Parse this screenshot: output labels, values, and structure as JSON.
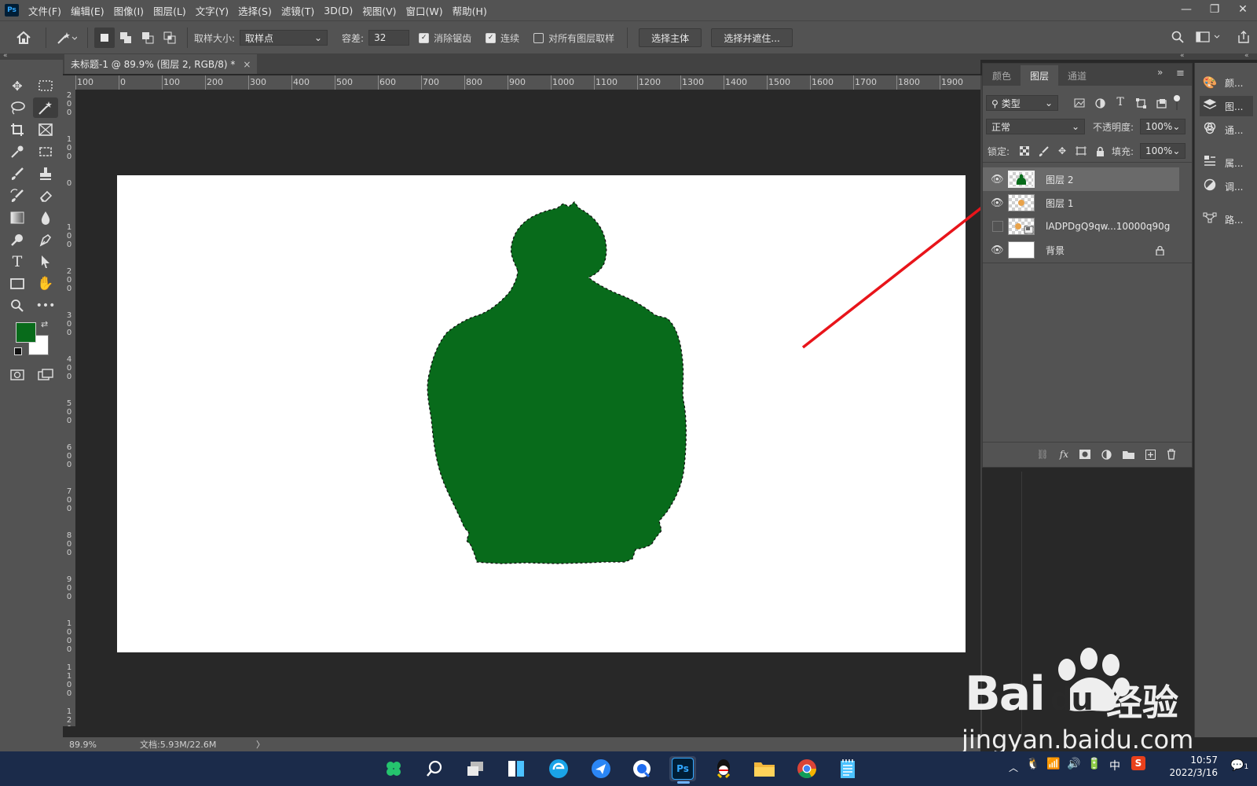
{
  "app": {
    "logo": "Ps"
  },
  "menu": [
    "文件(F)",
    "编辑(E)",
    "图像(I)",
    "图层(L)",
    "文字(Y)",
    "选择(S)",
    "滤镜(T)",
    "3D(D)",
    "视图(V)",
    "窗口(W)",
    "帮助(H)"
  ],
  "window_controls": {
    "minimize": "—",
    "restore": "❐",
    "close": "✕"
  },
  "options": {
    "sample_size_label": "取样大小:",
    "sample_size_value": "取样点",
    "tolerance_label": "容差:",
    "tolerance_value": "32",
    "anti_alias_label": "消除锯齿",
    "anti_alias_checked": true,
    "contiguous_label": "连续",
    "contiguous_checked": true,
    "sample_all_layers_label": "对所有图层取样",
    "sample_all_layers_checked": false,
    "select_subject_label": "选择主体",
    "select_and_mask_label": "选择并遮住..."
  },
  "document": {
    "tab_title": "未标题-1 @ 89.9% (图层 2, RGB/8) *",
    "tab_close": "×"
  },
  "ruler": {
    "h_labels": [
      "100",
      "0",
      "100",
      "200",
      "300",
      "400",
      "500",
      "600",
      "700",
      "800",
      "900",
      "1000",
      "1100",
      "1200",
      "1300",
      "1400",
      "1500",
      "1600",
      "1700",
      "1800",
      "1900"
    ],
    "v_labels": [
      "200",
      "100",
      "0",
      "100",
      "200",
      "300",
      "400",
      "500",
      "600",
      "700",
      "800",
      "900",
      "1000",
      "1100",
      "1200"
    ]
  },
  "colors": {
    "foreground": "#086b1b",
    "background": "#ffffff",
    "arrow": "#e8141a",
    "fill_shape": "#086b1b"
  },
  "status": {
    "zoom": "89.9%",
    "doc_size": "文档:5.93M/22.6M",
    "chevron": "〉"
  },
  "layers_panel": {
    "tabs": [
      "颜色",
      "图层",
      "通道"
    ],
    "active_tab": "图层",
    "filter_label": "类型",
    "blend_mode": "正常",
    "opacity_label": "不透明度:",
    "opacity_value": "100%",
    "lock_label": "锁定:",
    "fill_label": "填充:",
    "fill_value": "100%",
    "layers": [
      {
        "name": "图层 2",
        "visible": true,
        "selected": true
      },
      {
        "name": "图层 1",
        "visible": true,
        "selected": false
      },
      {
        "name": "lADPDgQ9qw...10000q90g",
        "visible": false,
        "selected": false
      },
      {
        "name": "背景",
        "visible": true,
        "selected": false,
        "locked": true
      }
    ]
  },
  "right_dock": [
    "颜...",
    "图...",
    "通...",
    "属...",
    "调...",
    "路..."
  ],
  "taskbar": {
    "time": "10:57",
    "date": "2022/3/16",
    "ime": "中",
    "notification_count": "1",
    "apps": [
      "clover-icon",
      "search-icon",
      "task-view-icon",
      "widgets-icon",
      "edge-icon",
      "feishu-icon",
      "qq-browser-icon",
      "photoshop-icon",
      "qq-icon",
      "file-explorer-icon",
      "chrome-icon",
      "notepad-icon"
    ]
  },
  "watermark": {
    "brand": "Bai",
    "brand2": "du",
    "cn": "经验",
    "url": "jingyan.baidu.com"
  }
}
